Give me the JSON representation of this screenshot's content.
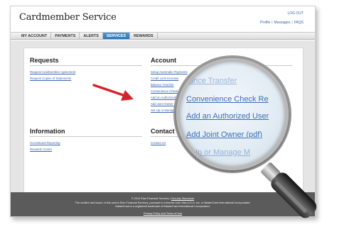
{
  "header": {
    "brand": "Cardmember Service",
    "logout": "LOG OUT",
    "links": [
      "Profile",
      "Messages",
      "FAQS"
    ],
    "link_separator": "|"
  },
  "nav": {
    "tabs": [
      "MY ACCOUNT",
      "PAYMENTS",
      "ALERTS",
      "SERVICES",
      "REWARDS"
    ],
    "active": "SERVICES"
  },
  "requests": {
    "heading": "Requests",
    "links": [
      "Request Cardmember Agreement",
      "Request Copies of Statements"
    ]
  },
  "account": {
    "heading": "Account",
    "links": [
      "Setup Automatic Payments",
      "Credit Limit Increase",
      "Balance Transfer",
      "Convenience Check",
      "Add an Authorized U",
      "Add Joint Owner (p",
      "Set Up or Manage"
    ]
  },
  "information": {
    "heading": "Information",
    "links": [
      "ScoreBoard Reporting",
      "Rewards Center"
    ]
  },
  "contact": {
    "heading": "Contact",
    "links": [
      "Contact Us"
    ]
  },
  "magnifier": {
    "lines": [
      "ance Transfer",
      "Convenience Check Re",
      "Add an Authorized User",
      "Add Joint Owner (pdf)",
      "Up or Manage M"
    ]
  },
  "footer": {
    "copyright": "© 2014 Elan Financial Services",
    "security": "Security Standards",
    "line2": "The creditor and issuer of this card is Elan Financial Services, pursuant to a license from Visa U.S.A. Inc. or MasterCard International Incorporated.",
    "line3": "MasterCard is a registered trademark of MasterCard International Incorporated.",
    "policy": "Privacy Policy and Terms of Use"
  },
  "colors": {
    "link": "#3b68b0",
    "tab_active": "#3a84c4",
    "arrow": "#d8222a",
    "footer_bg": "#5b5b5b"
  }
}
